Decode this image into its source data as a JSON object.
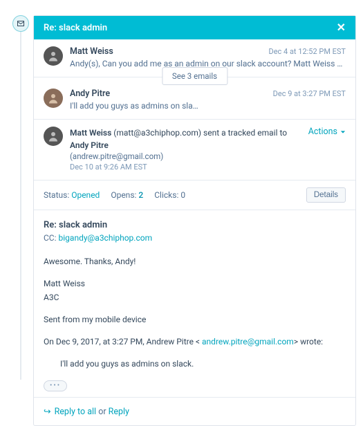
{
  "thread": {
    "subject": "Re: slack admin"
  },
  "see_more": "See 3 emails",
  "emails": [
    {
      "sender": "Matt Weiss",
      "timestamp": "Dec 4 at 12:52 PM EST",
      "preview": "Andy(s), Can you add me as an admin on our slack account? Matt Weiss Production Director   w:  …"
    },
    {
      "sender": "Andy Pitre",
      "timestamp": "Dec 9 at 3:27 PM EST",
      "preview": "I'll add you guys as admins on sla…"
    }
  ],
  "open_email": {
    "sender_name": "Matt Weiss",
    "sender_email": "(matt@a3chiphop.com)",
    "middle_text": " sent a tracked email to ",
    "recipient_name": "Andy Pitre",
    "recipient_email": "(andrew.pitre@gmail.com)",
    "timestamp": "Dec 10 at 9:26 AM EST",
    "actions_label": "Actions"
  },
  "status": {
    "label_status": "Status:",
    "status_value": "Opened",
    "label_opens": "Opens:",
    "opens_value": "2",
    "label_clicks": "Clicks:",
    "clicks_value": "0",
    "details_label": "Details"
  },
  "body": {
    "subject": "Re: slack admin",
    "cc_label": "CC:",
    "cc_email": "bigandy@a3chiphop.com",
    "line1": "Awesome. Thanks, Andy!",
    "sig1": "Matt Weiss",
    "sig2": "A3C",
    "sent_from": "Sent from my mobile device",
    "quote_intro_pre": "On Dec 9, 2017, at 3:27 PM, Andrew Pitre < ",
    "quote_intro_email": "andrew.pitre@gmail.com",
    "quote_intro_post": "> wrote:",
    "quoted_text": "I'll add you guys as admins on slack."
  },
  "footer": {
    "reply_all": "Reply to all",
    "or": " or ",
    "reply": "Reply"
  }
}
